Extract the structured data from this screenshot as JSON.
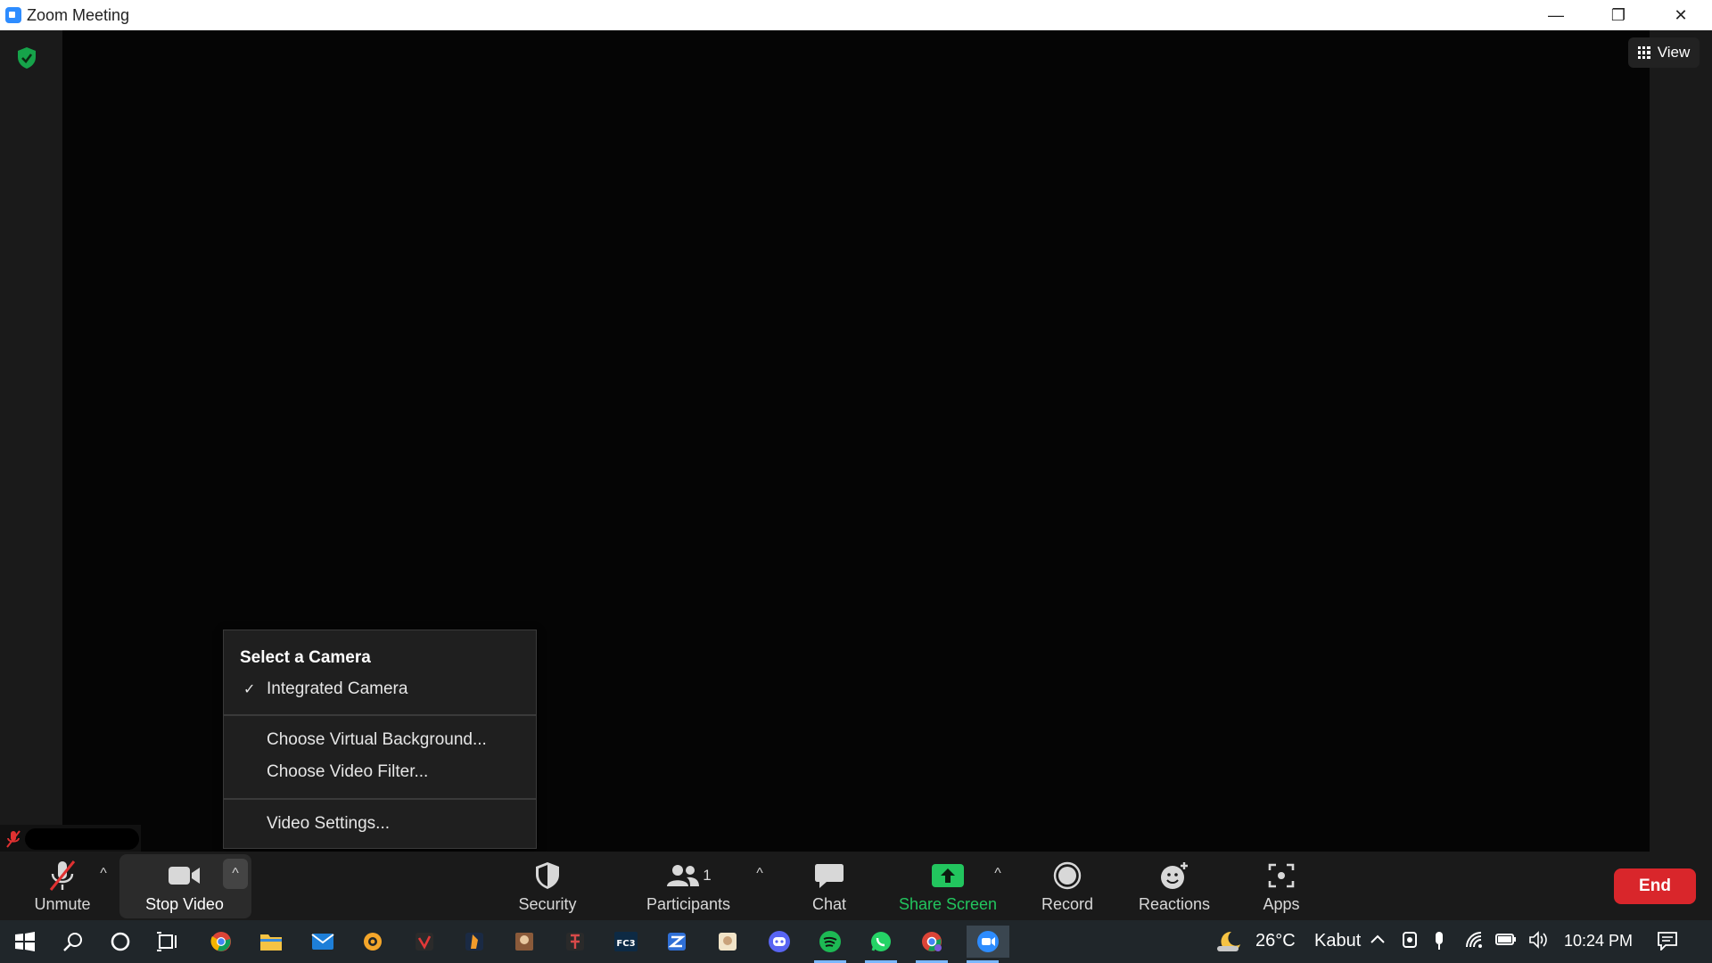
{
  "window": {
    "title": "Zoom Meeting",
    "minimize": "—",
    "restore": "❐",
    "close": "✕"
  },
  "meeting": {
    "view_label": "View"
  },
  "camera_menu": {
    "header": "Select a Camera",
    "selected_camera": "Integrated Camera",
    "check": "✓",
    "items": [
      "Choose Virtual Background...",
      "Choose Video Filter...",
      "Video Settings..."
    ]
  },
  "toolbar": {
    "unmute": "Unmute",
    "stop_video": "Stop Video",
    "security": "Security",
    "participants": "Participants",
    "participants_count": "1",
    "chat": "Chat",
    "share_screen": "Share Screen",
    "record": "Record",
    "reactions": "Reactions",
    "apps": "Apps",
    "end": "End",
    "caret": "^"
  },
  "taskbar": {
    "weather_temp": "26°C",
    "weather_desc": "Kabut",
    "time": "10:24 PM"
  },
  "colors": {
    "share_green": "#22c55e",
    "end_red": "#d9262b",
    "shield_green": "#16a34a"
  }
}
